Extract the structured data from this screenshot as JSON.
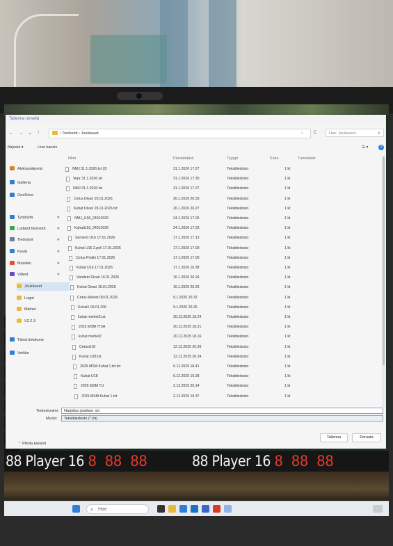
{
  "dialog": {
    "title": "Tallenna nimellä",
    "nav": {
      "back": "←",
      "forward": "→",
      "down": "⌄",
      "up": "↑"
    },
    "address": {
      "root": "Tiedostot",
      "sep": "›",
      "current": "Joukkueet",
      "chevron": "⌄",
      "refresh": "C"
    },
    "search_placeholder": "Hae: Joukkueet",
    "command_bar": {
      "organize": "Järjestä ▾",
      "new_folder": "Uusi kansio",
      "view": "☰ ▾",
      "help": "?"
    },
    "sidebar": [
      {
        "label": "Aloitusnäkymä",
        "color": "#d9822b",
        "pin": ""
      },
      {
        "label": "Galleria",
        "color": "#2f7fd6",
        "pin": ""
      },
      {
        "label": "OneDrive",
        "color": "#2f7fd6",
        "pin": ""
      },
      {
        "label": "Työpöytä",
        "color": "#2f7fd6",
        "pin": "✱"
      },
      {
        "label": "Ladatut tiedostot",
        "color": "#3aa356",
        "pin": "✱"
      },
      {
        "label": "Tiedostot",
        "color": "#6a7f99",
        "pin": "✱"
      },
      {
        "label": "Kuvat",
        "color": "#2f7fd6",
        "pin": "✱"
      },
      {
        "label": "Musiikki",
        "color": "#e0503a",
        "pin": "✱"
      },
      {
        "label": "Videot",
        "color": "#6a4bcf",
        "pin": "✱"
      },
      {
        "label": "Joukkueet",
        "color": "#e8b93a",
        "pin": ""
      },
      {
        "label": "Logot",
        "color": "#e8b93a",
        "pin": ""
      },
      {
        "label": "Miehet",
        "color": "#e8b93a",
        "pin": ""
      },
      {
        "label": "V2.2.3",
        "color": "#e8b93a",
        "pin": ""
      },
      {
        "label": "Tämä tietokone",
        "color": "#2f7fd6",
        "pin": ""
      },
      {
        "label": "Verkko",
        "color": "#2f7fd6",
        "pin": ""
      }
    ],
    "columns": {
      "name": "Nimi",
      "date": "Päivämäärä",
      "type": "Tyyppi",
      "size": "Koko",
      "tags": "Tunnisteet"
    },
    "files": [
      {
        "name": "NMJ 31.1.2026.txt (2)",
        "date": "31.1.2026 17.27",
        "type": "Tekstitiedosto",
        "size": "1 kt"
      },
      {
        "name": "Vepr 31.1.2026.txt",
        "date": "31.1.2026 17.30",
        "type": "Tekstitiedosto",
        "size": "1 kt"
      },
      {
        "name": "NMJ 31.1.2026.txt",
        "date": "31.1.2026 17.27",
        "type": "Tekstitiedosto",
        "size": "1 kt"
      },
      {
        "name": "Cetus Divari 26.01.2026",
        "date": "26.1.2026 20.33",
        "type": "Tekstitiedosto",
        "size": "1 kt"
      },
      {
        "name": "Kuhat Divari 26.01.2026.txt",
        "date": "26.1.2026 20.27",
        "type": "Tekstitiedosto",
        "size": "1 kt"
      },
      {
        "name": "NMJ_U18_24012026",
        "date": "24.1.2026 17.05",
        "type": "Tekstitiedosto",
        "size": "1 kt"
      },
      {
        "name": "KuhatU18_24012026",
        "date": "24.1.2026 17.03",
        "type": "Tekstitiedosto",
        "size": "1 kt"
      },
      {
        "name": "Semenit U16 17.01.2026",
        "date": "17.1.2026 17.13",
        "type": "Tekstitiedosto",
        "size": "1 kt"
      },
      {
        "name": "Kuhat U16 2.peli 17.01.2026",
        "date": "17.1.2026 17.09",
        "type": "Tekstitiedosto",
        "size": "1 kt"
      },
      {
        "name": "Cetus Pinkki 17.01.2026",
        "date": "17.1.2026 17.00",
        "type": "Tekstitiedosto",
        "size": "1 kt"
      },
      {
        "name": "Kuhat U16 17.01.2026",
        "date": "17.1.2026 16.38",
        "type": "Tekstitiedosto",
        "size": "1 kt"
      },
      {
        "name": "Vandem Divari 16.01.2026",
        "date": "16.1.2026 20.24",
        "type": "Tekstitiedosto",
        "size": "1 kt"
      },
      {
        "name": "Kuhat Divari 16.01.2026",
        "date": "16.1.2026 20.23",
        "type": "Tekstitiedosto",
        "size": "1 kt"
      },
      {
        "name": "Cetus Miehet 09.01.2026",
        "date": "9.1.2026 20.32",
        "type": "Tekstitiedosto",
        "size": "1 kt"
      },
      {
        "name": "Kuhat1 09.01.206",
        "date": "9.1.2026 20.26",
        "type": "Tekstitiedosto",
        "size": "1 kt"
      },
      {
        "name": "kuhat miehet2.txt",
        "date": "20.12.2025 18.24",
        "type": "Tekstitiedosto",
        "size": "1 kt"
      },
      {
        "name": "2025 MSM IYSA",
        "date": "20.12.2025 18.21",
        "type": "Tekstitiedosto",
        "size": "1 kt"
      },
      {
        "name": "kuhat miehet2",
        "date": "20.12.2025 18.16",
        "type": "Tekstitiedosto",
        "size": "1 kt"
      },
      {
        "name": "CetusU18",
        "date": "12.12.2025 20.26",
        "type": "Tekstitiedosto",
        "size": "1 kt"
      },
      {
        "name": "Kuhat U18.txt",
        "date": "12.12.2025 20.24",
        "type": "Tekstitiedosto",
        "size": "1 kt"
      },
      {
        "name": "2025 MSM Kuhat 1.txt.txt",
        "date": "6.12.2025 18.41",
        "type": "Tekstitiedosto",
        "size": "1 kt"
      },
      {
        "name": "Kuhat U18",
        "date": "6.12.2025 19.28",
        "type": "Tekstitiedosto",
        "size": "1 kt"
      },
      {
        "name": "2025 MSM TU",
        "date": "2.12.2025 20.14",
        "type": "Tekstitiedosto",
        "size": "1 kt"
      },
      {
        "name": "2025 MSM Kuhat 1.txt",
        "date": "2.12.2025 19.37",
        "type": "Tekstitiedosto",
        "size": "1 kt"
      }
    ],
    "filename_label": "Tiedostonimi:",
    "filename_value": "Harjoitus joukkue .txt",
    "type_label": "Muoto:",
    "type_value": "Tekstitiedosto (*.txt)",
    "save": "Tallenna",
    "cancel": "Peruuta",
    "hide_folders": "⌃ Piilota kansiot"
  },
  "scoreboard": {
    "left_digits": "88",
    "left_player": "Player 16",
    "left_score": "8 88 88",
    "right_digits": "88",
    "right_player": "Player 16",
    "right_score": "8 88 88",
    "side_digits": [
      "8",
      "8",
      "8",
      "8",
      "8",
      "8"
    ]
  },
  "taskbar": {
    "search": "Hae"
  }
}
